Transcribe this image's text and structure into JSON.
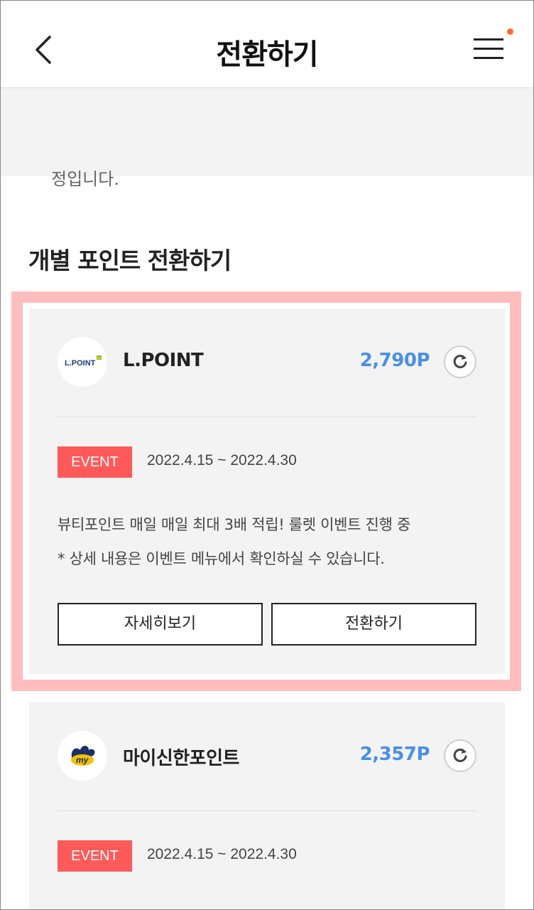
{
  "header": {
    "title": "전환하기"
  },
  "top_partial_text": "정입니다.",
  "section": {
    "title": "개별 포인트 전환하기"
  },
  "cards": [
    {
      "name": "L.POINT",
      "logo_text": "L.POINT",
      "points": "2,790P",
      "event_badge": "EVENT",
      "event_period": "2022.4.15 ~ 2022.4.30",
      "description_1": "뷰티포인트 매일 매일 최대 3배 적립! 룰렛 이벤트 진행 중",
      "description_2": "* 상세 내용은 이벤트 메뉴에서 확인하실 수 있습니다.",
      "detail_button": "자세히보기",
      "convert_button": "전환하기"
    },
    {
      "name": "마이신한포인트",
      "logo_text": "my",
      "points": "2,357P",
      "event_badge": "EVENT",
      "event_period": "2022.4.15 ~ 2022.4.30"
    }
  ],
  "colors": {
    "accent_points": "#4a90e2",
    "event_badge": "#ff5a5a",
    "highlight": "#ffbdbd",
    "notification_dot": "#ff6a2b"
  }
}
